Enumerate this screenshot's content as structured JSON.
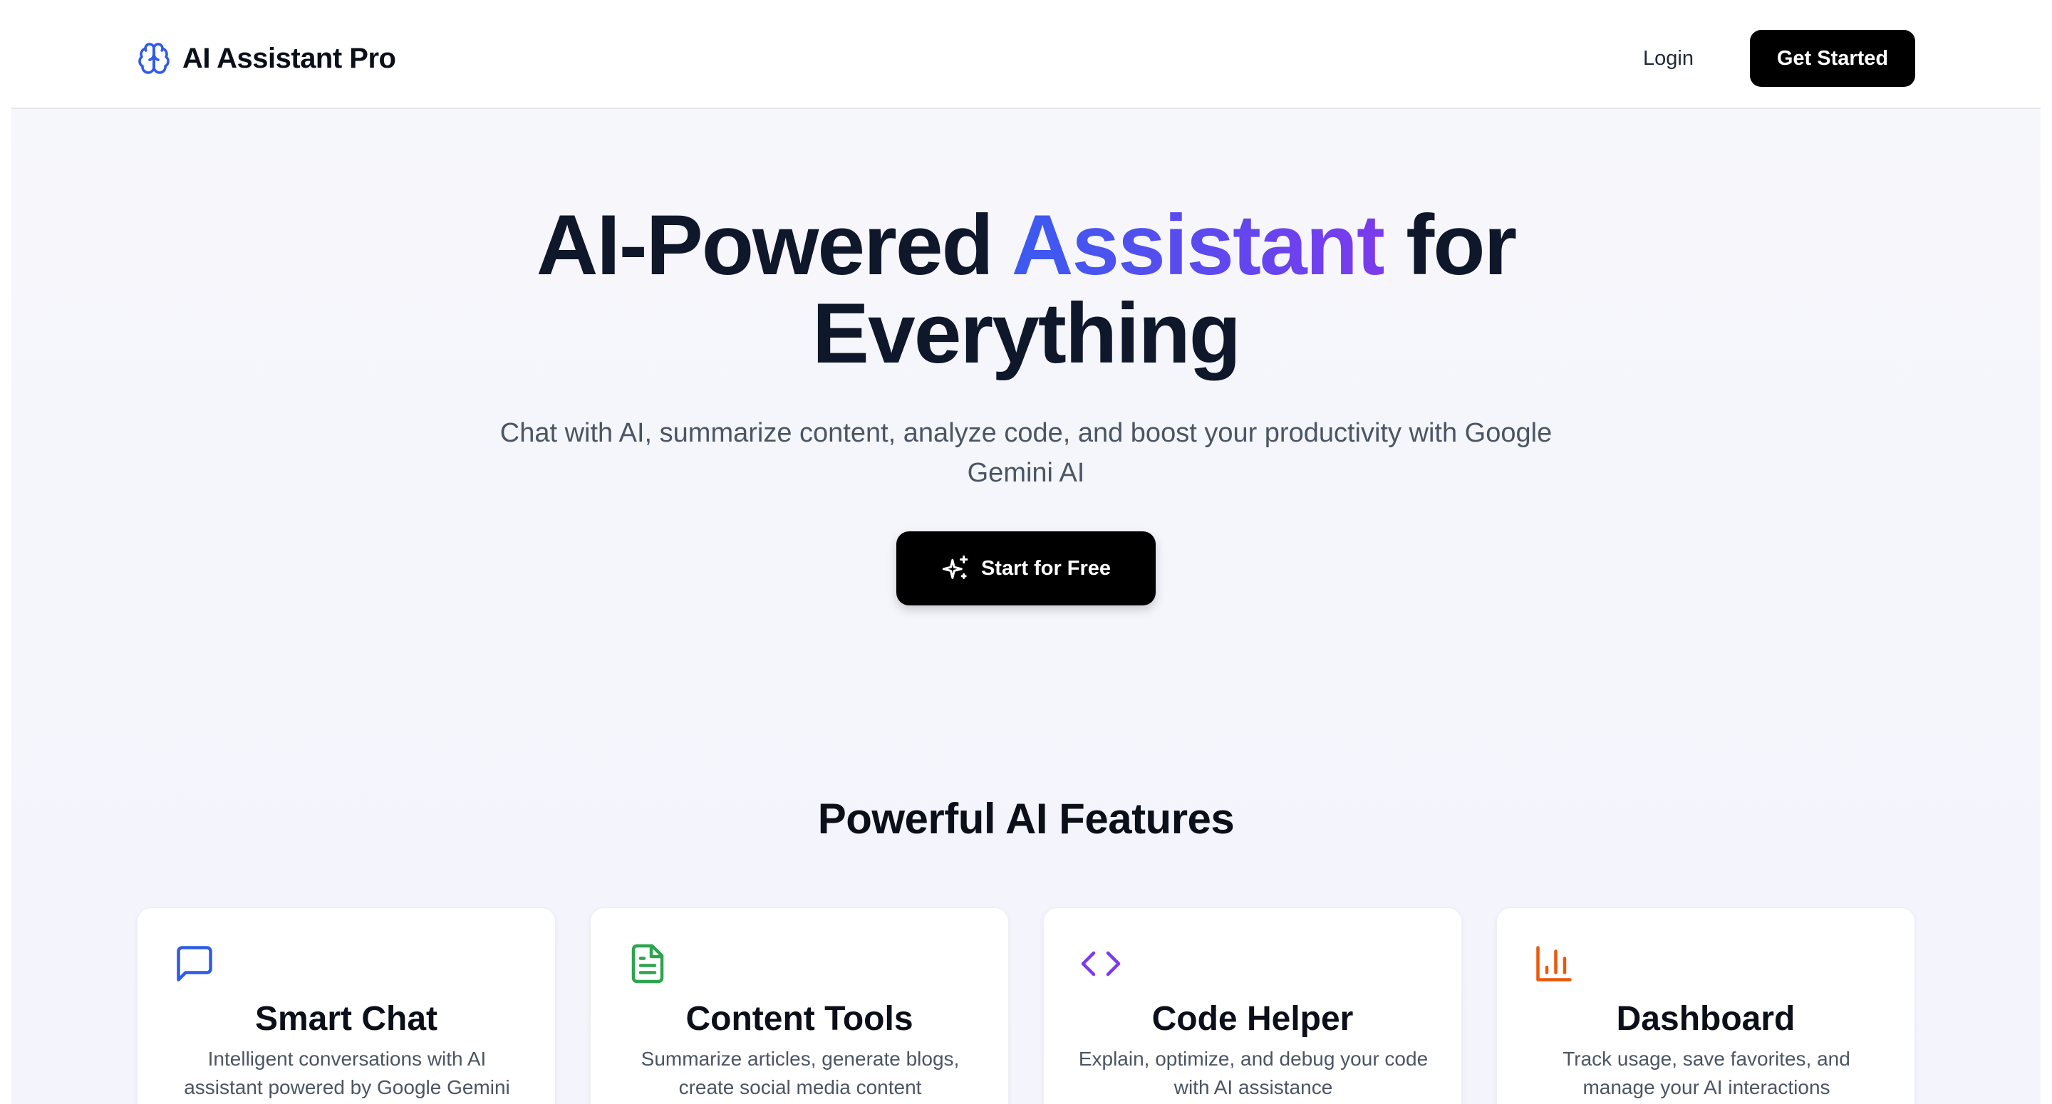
{
  "header": {
    "brand_title": "AI Assistant Pro",
    "brand_icon": "brain-icon",
    "login_label": "Login",
    "get_started_label": "Get Started"
  },
  "hero": {
    "title_part1": "AI-Powered ",
    "title_highlight": "Assistant",
    "title_part2": " for",
    "title_line2": "Everything",
    "subtitle": "Chat with AI, summarize content, analyze code, and boost your productivity with Google Gemini AI",
    "cta_label": "Start for Free",
    "cta_icon": "sparkles-icon"
  },
  "features": {
    "heading": "Powerful AI Features",
    "cards": [
      {
        "title": "Smart Chat",
        "description": "Intelligent conversations with AI assistant powered by Google Gemini",
        "icon": "chat-bubble-icon",
        "color": "#2f5be7"
      },
      {
        "title": "Content Tools",
        "description": "Summarize articles, generate blogs, create social media content",
        "icon": "document-icon",
        "color": "#2ea44f"
      },
      {
        "title": "Code Helper",
        "description": "Explain, optimize, and debug your code with AI assistance",
        "icon": "code-brackets-icon",
        "color": "#7c3aed"
      },
      {
        "title": "Dashboard",
        "description": "Track usage, save favorites, and manage your AI interactions",
        "icon": "bar-chart-icon",
        "color": "#ea580c"
      }
    ]
  },
  "colors": {
    "accent_gradient_start": "#3b5bf0",
    "accent_gradient_end": "#7c3aed",
    "primary_button": "#000000",
    "brand_icon": "#2f5be7"
  }
}
